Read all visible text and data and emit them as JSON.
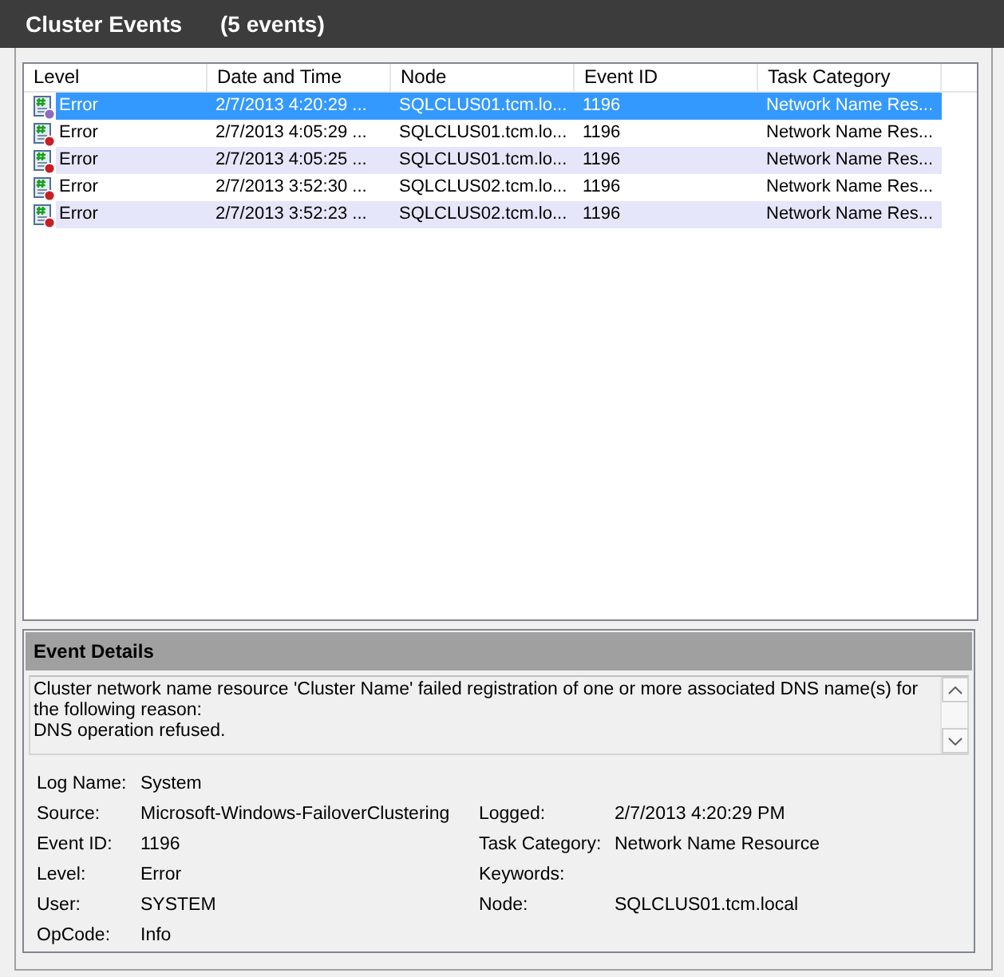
{
  "header": {
    "title": "Cluster Events",
    "count": "(5 events)"
  },
  "events_table": {
    "columns": [
      "Level",
      "Date and Time",
      "Node",
      "Event ID",
      "Task Category"
    ],
    "rows": [
      {
        "selected": true,
        "level": "Error",
        "date_time": "2/7/2013 4:20:29 ...",
        "node": "SQLCLUS01.tcm.lo...",
        "event_id": "1196",
        "task_category": "Network Name Res..."
      },
      {
        "selected": false,
        "level": "Error",
        "date_time": "2/7/2013 4:05:29 ...",
        "node": "SQLCLUS01.tcm.lo...",
        "event_id": "1196",
        "task_category": "Network Name Res..."
      },
      {
        "selected": false,
        "level": "Error",
        "date_time": "2/7/2013 4:05:25 ...",
        "node": "SQLCLUS01.tcm.lo...",
        "event_id": "1196",
        "task_category": "Network Name Res..."
      },
      {
        "selected": false,
        "level": "Error",
        "date_time": "2/7/2013 3:52:30 ...",
        "node": "SQLCLUS02.tcm.lo...",
        "event_id": "1196",
        "task_category": "Network Name Res..."
      },
      {
        "selected": false,
        "level": "Error",
        "date_time": "2/7/2013 3:52:23 ...",
        "node": "SQLCLUS02.tcm.lo...",
        "event_id": "1196",
        "task_category": "Network Name Res..."
      }
    ]
  },
  "event_details": {
    "title": "Event Details",
    "message": "Cluster network name resource 'Cluster Name' failed registration of one or more associated DNS name(s) for the following reason:\nDNS operation refused.",
    "rows": [
      {
        "fields": [
          {
            "label": "Log Name:",
            "value": "System"
          }
        ]
      },
      {
        "fields": [
          {
            "label": "Source:",
            "value": "Microsoft-Windows-FailoverClustering"
          },
          {
            "label": "Logged:",
            "value": "2/7/2013 4:20:29 PM"
          }
        ]
      },
      {
        "fields": [
          {
            "label": "Event ID:",
            "value": "1196"
          },
          {
            "label": "Task Category:",
            "value": "Network Name Resource"
          }
        ]
      },
      {
        "fields": [
          {
            "label": "Level:",
            "value": "Error"
          },
          {
            "label": "Keywords:"
          }
        ]
      },
      {
        "fields": [
          {
            "label": "User:",
            "value": "SYSTEM"
          },
          {
            "label": "Node:",
            "value": "SQLCLUS01.tcm.local"
          }
        ]
      },
      {
        "fields": [
          {
            "label": "OpCode:",
            "value": "Info"
          }
        ]
      }
    ]
  }
}
